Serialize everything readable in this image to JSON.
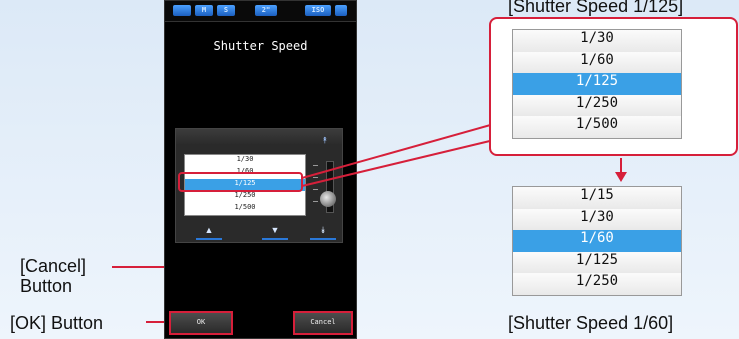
{
  "captions": {
    "top": "[Shutter Speed 1/125]",
    "bottom": "[Shutter Speed 1/60]",
    "cancel_line1": "[Cancel]",
    "cancel_line2": "Button",
    "ok": "[OK] Button"
  },
  "device": {
    "status_bar": [
      "M",
      "S",
      "2\"",
      "ISO"
    ],
    "screen_title": "Shutter Speed",
    "list_items": [
      "1/30",
      "1/60",
      "1/125",
      "1/250",
      "1/500"
    ],
    "selected_index": 2,
    "nav": {
      "up": "▲",
      "down": "▼",
      "page_down": "⯯",
      "page_up": "⯭"
    },
    "ok_label": "OK",
    "cancel_label": "Cancel"
  },
  "zoom_before": [
    "1/30",
    "1/60",
    "1/125",
    "1/250",
    "1/500"
  ],
  "zoom_after": [
    "1/15",
    "1/30",
    "1/60",
    "1/125",
    "1/250"
  ],
  "colors": {
    "accent_red": "#d61f3a",
    "selection_blue": "#3aa0e6"
  }
}
